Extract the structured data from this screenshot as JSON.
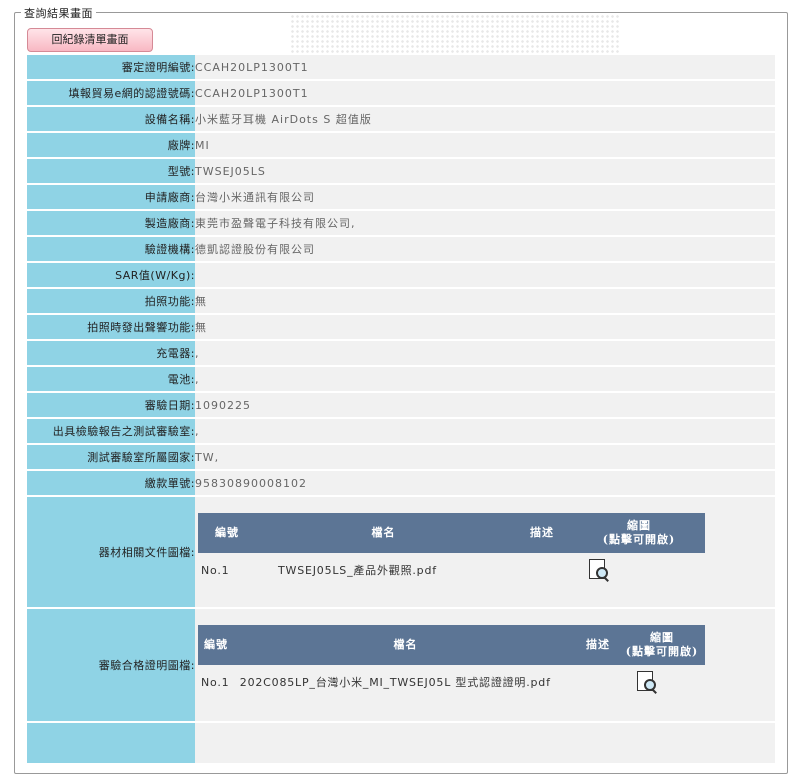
{
  "section_legend": "查詢結果畫面",
  "back_button_label": "回紀錄清單畫面",
  "fields": [
    {
      "label": "審定證明編號:",
      "value": "CCAH20LP1300T1"
    },
    {
      "label": "填報貿易e網的認證號碼:",
      "value": "CCAH20LP1300T1"
    },
    {
      "label": "設備名稱:",
      "value": "小米藍牙耳機 AirDots S 超值版"
    },
    {
      "label": "廠牌:",
      "value": "MI"
    },
    {
      "label": "型號:",
      "value": "TWSEJ05LS"
    },
    {
      "label": "申請廠商:",
      "value": "台灣小米通訊有限公司"
    },
    {
      "label": "製造廠商:",
      "value": "東莞市盈聲電子科技有限公司,"
    },
    {
      "label": "驗證機構:",
      "value": "德凱認證股份有限公司"
    },
    {
      "label": "SAR值(W/Kg):",
      "value": ""
    },
    {
      "label": "拍照功能:",
      "value": "無"
    },
    {
      "label": "拍照時發出聲響功能:",
      "value": "無"
    },
    {
      "label": "充電器:",
      "value": ","
    },
    {
      "label": "電池:",
      "value": ","
    },
    {
      "label": "審驗日期:",
      "value": "1090225"
    },
    {
      "label": "出具檢驗報告之測試審驗室:",
      "value": ","
    },
    {
      "label": "測試審驗室所屬國家:",
      "value": "TW,"
    },
    {
      "label": "繳款單號:",
      "value": "95830890008102"
    }
  ],
  "equipment_docs": {
    "label": "器材相關文件圖檔:",
    "headers": {
      "no": "編號",
      "name": "檔名",
      "desc": "描述",
      "thumb_line1": "縮圖",
      "thumb_line2": "(點擊可開啟)"
    },
    "rows": [
      {
        "no": "No.1",
        "file": "TWSEJ05LS_產品外觀照.pdf",
        "desc": ""
      }
    ]
  },
  "approval_docs": {
    "label": "審驗合格證明圖檔:",
    "headers": {
      "no": "編號",
      "name": "檔名",
      "desc": "描述",
      "thumb_line1": "縮圖",
      "thumb_line2": "(點擊可開啟)"
    },
    "rows": [
      {
        "no": "No.1",
        "file": "202C085LP_台灣小米_MI_TWSEJ05L 型式認證證明.pdf",
        "desc": ""
      }
    ]
  },
  "icons": {
    "back": "",
    "thumb": "document-magnifier-icon"
  }
}
